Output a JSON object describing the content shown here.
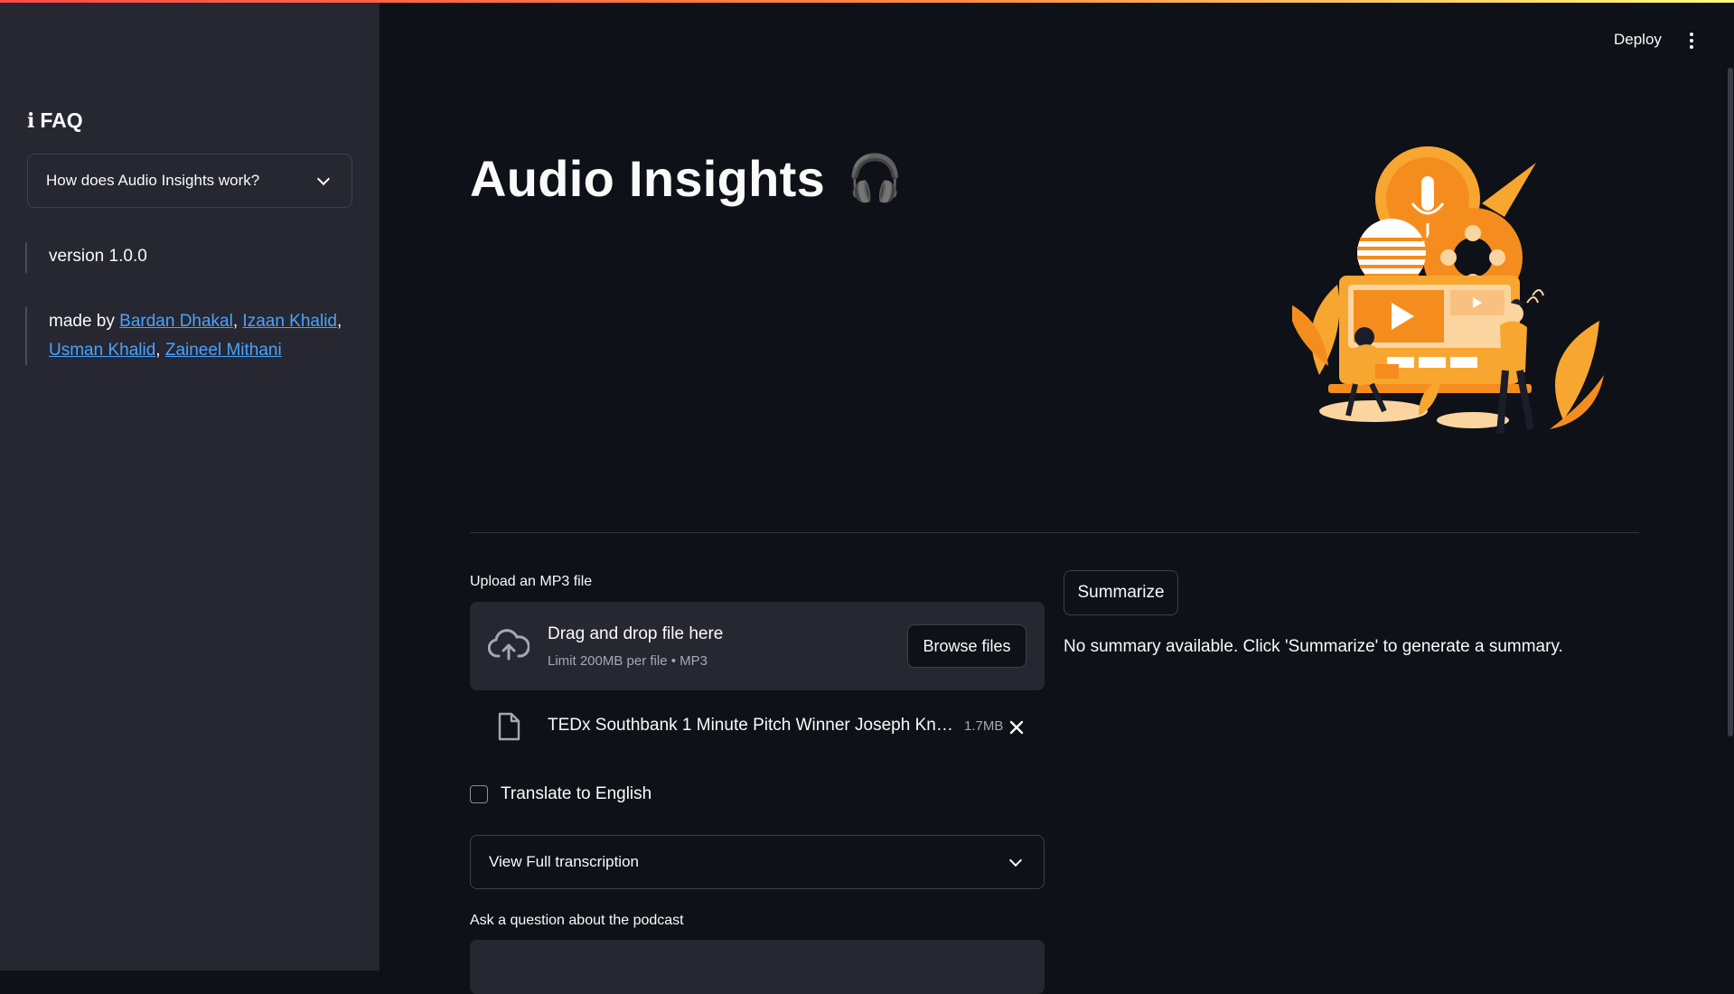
{
  "sidebar": {
    "faq_title": "FAQ",
    "faq_expander_label": "How does Audio Insights work?",
    "version": "version 1.0.0",
    "made_by_prefix": "made by ",
    "authors": [
      "Bardan Dhakal",
      "Izaan Khalid",
      "Usman Khalid",
      "Zaineel Mithani"
    ]
  },
  "header": {
    "deploy_label": "Deploy"
  },
  "main": {
    "title": "Audio Insights",
    "title_emoji": "🎧",
    "upload": {
      "label": "Upload an MP3 file",
      "drop_text": "Drag and drop file here",
      "limit_text": "Limit 200MB per file • MP3",
      "browse_label": "Browse files"
    },
    "file": {
      "name": "TEDx Southbank 1 Minute Pitch Winner Joseph Kno...",
      "size": "1.7MB"
    },
    "translate_label": "Translate to English",
    "transcription_expander_label": "View Full transcription",
    "ask_label": "Ask a question about the podcast",
    "ask_value": "",
    "summarize_label": "Summarize",
    "summary_text": "No summary available. Click 'Summarize' to generate a summary."
  },
  "colors": {
    "background": "#0e1117",
    "sidebar": "#262730",
    "link": "#4aa3ff",
    "accent_orange": "#f7941d"
  }
}
